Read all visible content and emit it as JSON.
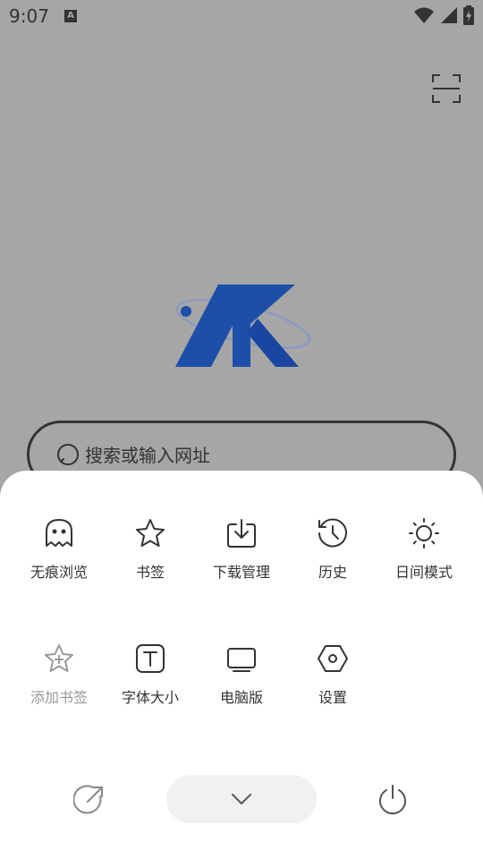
{
  "status_bar": {
    "time": "9:07",
    "notification_icon": "A"
  },
  "search": {
    "placeholder": "搜索或输入网址"
  },
  "menu": {
    "row1": [
      {
        "label": "无痕浏览",
        "icon": "ghost-icon"
      },
      {
        "label": "书签",
        "icon": "star-icon"
      },
      {
        "label": "下载管理",
        "icon": "download-icon"
      },
      {
        "label": "历史",
        "icon": "history-icon"
      },
      {
        "label": "日间模式",
        "icon": "sun-icon"
      }
    ],
    "row2": [
      {
        "label": "添加书签",
        "icon": "star-plus-icon",
        "disabled": true
      },
      {
        "label": "字体大小",
        "icon": "text-size-icon"
      },
      {
        "label": "电脑版",
        "icon": "desktop-icon"
      },
      {
        "label": "设置",
        "icon": "settings-hex-icon"
      }
    ]
  },
  "bottom_bar": {
    "share_icon": "share-arrow-icon",
    "collapse_icon": "chevron-down-icon",
    "power_icon": "power-icon"
  },
  "colors": {
    "overlay_bg": "#a6a6a6",
    "logo_blue": "#1d4fa8",
    "sheet_bg": "#ffffff",
    "text": "#333333",
    "disabled_text": "#999999"
  }
}
